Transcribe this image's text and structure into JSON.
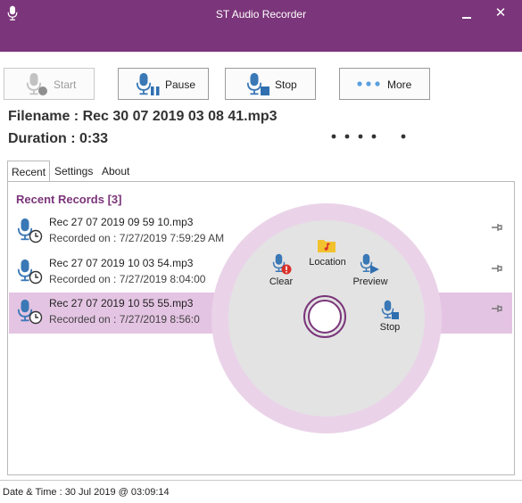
{
  "window": {
    "title": "ST Audio Recorder",
    "close_glyph": "✕"
  },
  "toolbar": {
    "start": {
      "label": "Start",
      "enabled": false,
      "icon": "microphone-icon"
    },
    "pause": {
      "label": "Pause",
      "icon": "microphone-pause-icon"
    },
    "stop": {
      "label": "Stop",
      "icon": "microphone-stop-icon"
    },
    "more": {
      "label": "More",
      "icon": "dots-icon"
    }
  },
  "info": {
    "filename": "Filename : Rec 30 07 2019 03 08 41.mp3",
    "duration": "Duration : 0:33"
  },
  "tabs": [
    {
      "label": "Recent",
      "active": true
    },
    {
      "label": "Settings",
      "active": false
    },
    {
      "label": "About",
      "active": false
    }
  ],
  "recent": {
    "header": "Recent Records [3]",
    "items": [
      {
        "name": "Rec 27 07 2019 09 59 10.mp3",
        "recorded": "Recorded on : 7/27/2019 7:59:29 AM",
        "selected": false
      },
      {
        "name": "Rec 27 07 2019 10 03 54.mp3",
        "recorded": "Recorded on : 7/27/2019 8:04:00",
        "selected": false
      },
      {
        "name": "Rec 27 07 2019 10 55 55.mp3",
        "recorded": "Recorded on : 7/27/2019 8:56:0",
        "selected": true
      }
    ]
  },
  "radial_menu": {
    "location": "Location",
    "clear": "Clear",
    "preview": "Preview",
    "stop": "Stop"
  },
  "status": {
    "datetime": "Date & Time : 30 Jul 2019 @ 03:09:14"
  },
  "colors": {
    "title_bar": "#7b357a",
    "accent": "#7b357a",
    "selected_row": "#e4c4e3",
    "mic_blue": "#3a78b6",
    "stop_blue": "#2f6fb0",
    "clear_red": "#d9312a",
    "folder_yellow": "#f2c12e"
  }
}
